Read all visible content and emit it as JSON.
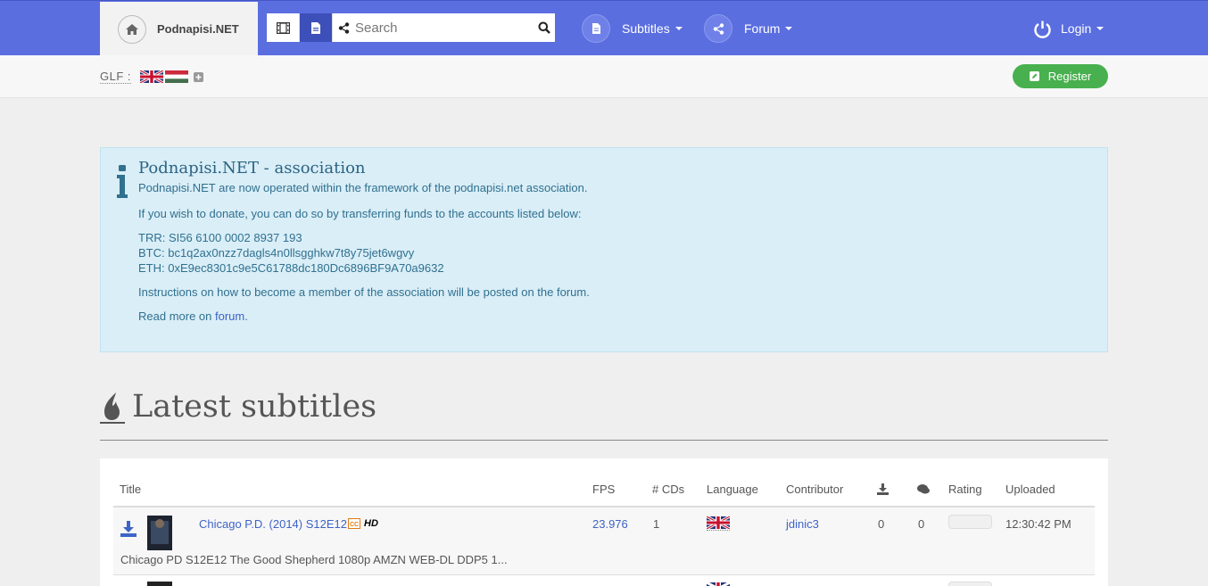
{
  "brand": {
    "name": "Podnapisi.NET"
  },
  "search": {
    "placeholder": "Search"
  },
  "nav": {
    "subtitles": "Subtitles",
    "forum": "Forum",
    "login": "Login"
  },
  "glf": {
    "label": "GLF :"
  },
  "register": {
    "label": "Register"
  },
  "alert": {
    "title": "Podnapisi.NET - association",
    "line1": "Podnapisi.NET are now operated within the framework of the podnapisi.net association.",
    "line2": "If you wish to donate, you can do so by transferring funds to the accounts listed below:",
    "trr": "TRR: SI56 6100 0002 8937 193",
    "btc": "BTC: bc1q2ax0nzz7dagls4n0llsgghkw7t8y75jet6wgvy",
    "eth": "ETH: 0xE9ec8301c9e5C61788dc180Dc6896BF9A70a9632",
    "line3": "Instructions on how to become a member of the association will be posted on the forum.",
    "readmore": "Read more on ",
    "forum_link": "forum",
    "period": "."
  },
  "latest": {
    "title": "Latest subtitles"
  },
  "table": {
    "headers": {
      "title": "Title",
      "fps": "FPS",
      "cds": "# CDs",
      "language": "Language",
      "contributor": "Contributor",
      "rating": "Rating",
      "uploaded": "Uploaded"
    },
    "rows": [
      {
        "title": "Chicago P.D. (2014) S12E12",
        "hd": "HD",
        "fps": "23.976",
        "cds": "1",
        "contributor": "jdinic3",
        "downloads": "0",
        "comments": "0",
        "uploaded": "12:30:42 PM",
        "release": "Chicago PD S12E12 The Good Shepherd 1080p AMZN WEB-DL DDP5 1..."
      }
    ]
  },
  "colors": {
    "navbar": "#5a6ee0",
    "register": "#48b04e",
    "alert_bg": "#d9eef7",
    "link": "#3f63c7"
  }
}
